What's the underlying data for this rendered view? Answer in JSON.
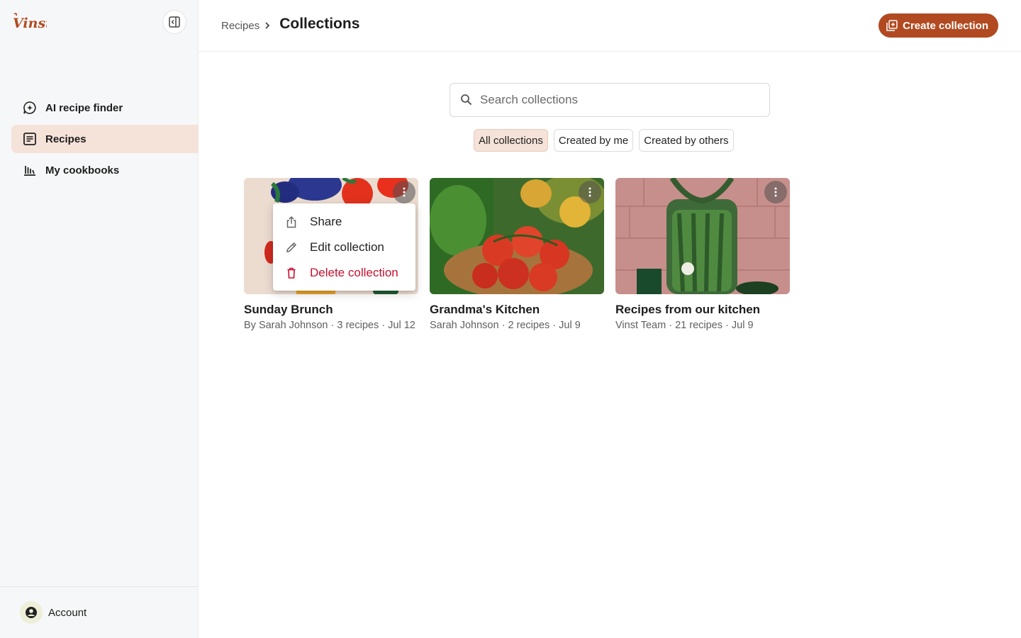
{
  "app": {
    "logo_text": "Vinst",
    "brand_color": "#b24a21"
  },
  "sidebar": {
    "items": [
      {
        "label": "AI recipe finder",
        "icon": "chat-sparkle-icon",
        "active": false
      },
      {
        "label": "Recipes",
        "icon": "recipe-book-icon",
        "active": true
      },
      {
        "label": "My cookbooks",
        "icon": "bookshelf-icon",
        "active": false
      }
    ],
    "account_label": "Account"
  },
  "header": {
    "breadcrumb_parent": "Recipes",
    "title": "Collections",
    "create_label": "Create collection"
  },
  "search": {
    "placeholder": "Search collections",
    "value": ""
  },
  "filters": [
    {
      "label": "All collections",
      "active": true
    },
    {
      "label": "Created by me",
      "active": false
    },
    {
      "label": "Created by others",
      "active": false
    }
  ],
  "collections": [
    {
      "title": "Sunday Brunch",
      "author": "By Sarah Johnson",
      "recipes": "3 recipes",
      "date": "Jul 12"
    },
    {
      "title": "Grandma's Kitchen",
      "author": "Sarah Johnson",
      "recipes": "2 recipes",
      "date": "Jul 9"
    },
    {
      "title": "Recipes from our kitchen",
      "author": "Vinst Team",
      "recipes": "21 recipes",
      "date": "Jul 9"
    }
  ],
  "meta_separator": " · ",
  "context_menu": {
    "share": "Share",
    "edit": "Edit collection",
    "delete": "Delete collection"
  }
}
